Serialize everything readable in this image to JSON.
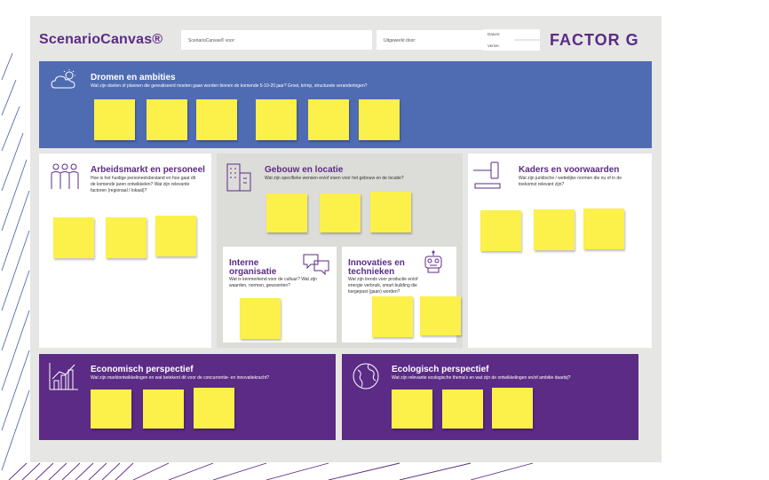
{
  "header": {
    "brand": "ScenarioCanvas®",
    "field_for": "ScenarioCanvas® voor:",
    "field_by": "Uitgewerkt door:",
    "field_date": "Datum:",
    "field_version": "Versie:",
    "logo": "FACTOR G"
  },
  "panels": {
    "dromen": {
      "title": "Dromen en ambities",
      "desc": "Wat zijn doelen of plannen die gerealiseerd moeten gaan worden binnen de komende 5-10-20 jaar? Groei, krimp, structurele veranderingen?",
      "notes": 6
    },
    "arbeid": {
      "title": "Arbeidsmarkt en personeel",
      "desc": "Hoe is het huidige personeelsbestand en hoe gaat dit de komende jaren ontwikkelen? Wat zijn relevante factoren (regionaal / lokaal)?",
      "notes": 3
    },
    "gebouw": {
      "title": "Gebouw en locatie",
      "desc": "Wat zijn specifieke wensen en/of eisen voor het gebouw en de locatie?",
      "notes": 3
    },
    "interne": {
      "title": "Interne organisatie",
      "desc": "Wat is kenmerkend voor de cultuur? Wat zijn waarden, normen, gewoonten?",
      "notes": 1
    },
    "innovaties": {
      "title": "Innovaties en technieken",
      "desc": "Wat zijn trends voor productie en/of energie verbruik, smart building die toegepast (gaan) worden?",
      "notes": 2
    },
    "kaders": {
      "title": "Kaders en voorwaarden",
      "desc": "Wat zijn juridische / wettelijke normen die nu of in de toekomst relevant zijn?",
      "notes": 3
    },
    "economisch": {
      "title": "Economisch perspectief",
      "desc": "Wat zijn marktontwikkelingen en wat betekent dit voor de concurrentie- en innovatiekracht?",
      "notes": 3
    },
    "ecologisch": {
      "title": "Ecologisch perspectief",
      "desc": "Wat zijn relevante ecologische thema's en wat zijn de ontwikkelingen en/of ambitie daarbij?",
      "notes": 3
    }
  },
  "colors": {
    "blue": "#4f6cb2",
    "purple": "#5b2b86",
    "sticky": "#fcf04a",
    "board": "#e6e6e4"
  },
  "icons": [
    "cloud-sun-icon",
    "people-icon",
    "building-icon",
    "chat-bubbles-icon",
    "robot-icon",
    "gavel-icon",
    "chart-growth-icon",
    "globe-icon"
  ]
}
